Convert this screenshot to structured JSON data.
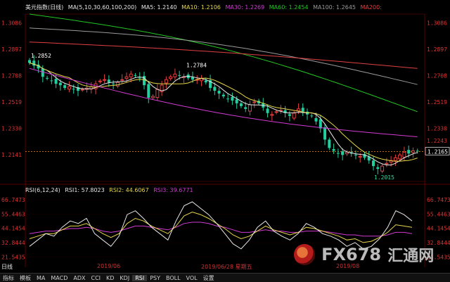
{
  "header": {
    "symbol": "美元指数(日线)",
    "ma_label": "MA(5,10,30,60,100,200)",
    "ma_values": [
      {
        "label": "MA5: 1.2140",
        "color": "#e6e6e6"
      },
      {
        "label": "MA10: 1.2106",
        "color": "#e6d64a"
      },
      {
        "label": "MA30: 1.2269",
        "color": "#d23ad2"
      },
      {
        "label": "MA60: 1.2454",
        "color": "#22c622"
      },
      {
        "label": "MA100: 1.2645",
        "color": "#9a9a9a"
      },
      {
        "label": "MA200:",
        "color": "#e04040"
      }
    ]
  },
  "price_axis": {
    "left_ticks": [
      "1.3086",
      "1.2897",
      "1.2708",
      "1.2519",
      "1.2330",
      "1.2141"
    ],
    "right_ticks": [
      "1.3086",
      "1.2897",
      "1.2708",
      "1.2519",
      "1.2330",
      "1.2243"
    ],
    "current_price": "1.2165"
  },
  "annotations": {
    "left_high": "1.2852",
    "mid_high": "1.2784",
    "low": "1.2015"
  },
  "rsi": {
    "title": "RSI(6,12,24)",
    "rsi1": "RSI1: 57.8023",
    "rsi2": "RSI2: 44.6067",
    "rsi3": "RSI3: 39.6771",
    "ticks_left": [
      "66.7473",
      "55.4463",
      "44.1454",
      "32.8444",
      "21.5435"
    ],
    "ticks_right": [
      "66.7473",
      "55.4463",
      "44.1454",
      "32.8444",
      "21.5435"
    ],
    "colors": {
      "rsi1": "#e6e6e6",
      "rsi2": "#e6d64a",
      "rsi3": "#d23ad2"
    }
  },
  "time_axis": {
    "left_label": "日线",
    "label_1": "2019/06",
    "label_2": "2019/06/28 星期五",
    "label_3": "2019/08"
  },
  "tabs": {
    "items": [
      "指标",
      "模板",
      "MA",
      "MACD",
      "ADX",
      "CCI",
      "KD",
      "KDJ",
      "RSI",
      "PSY",
      "BOLL",
      "VOL",
      "设置"
    ],
    "active": "RSI"
  },
  "watermark": {
    "brand": "FX678",
    "brand_cn": "汇通网"
  },
  "chart_data": {
    "type": "candlestick",
    "ma_periods": [
      5,
      10,
      30,
      60,
      100,
      200
    ],
    "y_ticks": [
      1.2141,
      1.233,
      1.2519,
      1.2708,
      1.2897,
      1.3086
    ],
    "last": 1.2165,
    "annotated_high": 1.2852,
    "annotated_mid_high": 1.2784,
    "annotated_low": 1.2015,
    "closes": [
      1.28,
      1.278,
      1.276,
      1.27,
      1.269,
      1.267,
      1.265,
      1.264,
      1.262,
      1.263,
      1.261,
      1.26,
      1.261,
      1.262,
      1.263,
      1.265,
      1.267,
      1.268,
      1.266,
      1.265,
      1.266,
      1.268,
      1.27,
      1.272,
      1.271,
      1.269,
      1.264,
      1.255,
      1.256,
      1.261,
      1.264,
      1.268,
      1.27,
      1.272,
      1.271,
      1.27,
      1.269,
      1.268,
      1.268,
      1.269,
      1.266,
      1.262,
      1.26,
      1.258,
      1.256,
      1.254,
      1.253,
      1.251,
      1.249,
      1.247,
      1.25,
      1.252,
      1.251,
      1.248,
      1.244,
      1.243,
      1.245,
      1.246,
      1.244,
      1.242,
      1.244,
      1.247,
      1.245,
      1.243,
      1.242,
      1.238,
      1.233,
      1.225,
      1.219,
      1.217,
      1.215,
      1.214,
      1.216,
      1.215,
      1.214,
      1.213,
      1.212,
      1.21,
      1.206,
      1.204,
      1.206,
      1.208,
      1.21,
      1.212,
      1.214,
      1.216,
      1.215,
      1.217,
      1.2165
    ],
    "rsi_series": {
      "RSI1": [
        30,
        35,
        40,
        38,
        45,
        50,
        48,
        52,
        40,
        35,
        30,
        38,
        55,
        58,
        52,
        45,
        40,
        35,
        50,
        62,
        65,
        60,
        55,
        48,
        40,
        32,
        28,
        35,
        45,
        50,
        42,
        38,
        35,
        40,
        48,
        45,
        40,
        38,
        35,
        30,
        33,
        28,
        30,
        36,
        45,
        58,
        55,
        50
      ],
      "RSI2": [
        36,
        38,
        40,
        40,
        43,
        46,
        46,
        48,
        44,
        40,
        37,
        40,
        48,
        52,
        50,
        46,
        43,
        40,
        46,
        54,
        57,
        55,
        52,
        48,
        44,
        39,
        36,
        38,
        42,
        46,
        43,
        41,
        39,
        41,
        45,
        44,
        42,
        40,
        38,
        35,
        36,
        33,
        34,
        37,
        41,
        47,
        46,
        45
      ],
      "RSI3": [
        40,
        41,
        42,
        42,
        43,
        44,
        44,
        45,
        44,
        42,
        41,
        42,
        44,
        46,
        46,
        45,
        44,
        43,
        45,
        48,
        49,
        49,
        48,
        46,
        45,
        43,
        41,
        41,
        42,
        43,
        42,
        42,
        41,
        41,
        42,
        42,
        42,
        41,
        40,
        39,
        39,
        38,
        38,
        38,
        39,
        41,
        41,
        40
      ]
    }
  }
}
